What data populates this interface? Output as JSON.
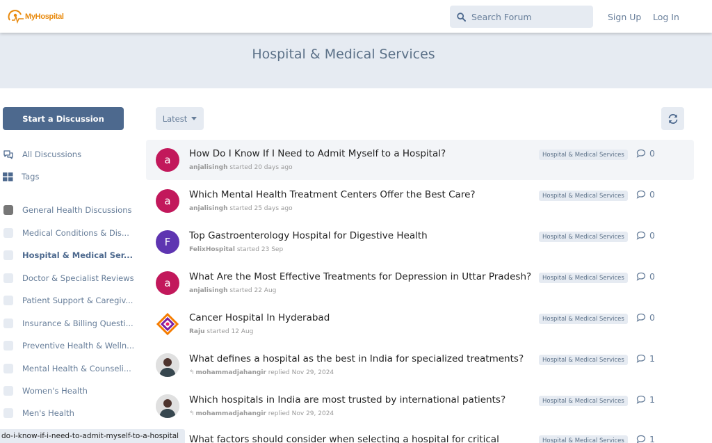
{
  "header": {
    "logo_text": "MyHospital",
    "search_placeholder": "Search Forum",
    "signup_label": "Sign Up",
    "login_label": "Log In"
  },
  "hero": {
    "title": "Hospital & Medical Services"
  },
  "sidebar": {
    "start_label": "Start a Discussion",
    "nav": [
      {
        "label": "All Discussions",
        "icon": "comments-icon"
      },
      {
        "label": "Tags",
        "icon": "grid-icon"
      }
    ],
    "tags": [
      {
        "label": "General Health Discussions"
      },
      {
        "label": "Medical Conditions & Dis..."
      },
      {
        "label": "Hospital & Medical Ser..."
      },
      {
        "label": "Doctor & Specialist Reviews"
      },
      {
        "label": "Patient Support & Caregiv..."
      },
      {
        "label": "Insurance & Billing Questi..."
      },
      {
        "label": "Preventive Health & Welln..."
      },
      {
        "label": "Mental Health & Counseli..."
      },
      {
        "label": "Women's Health"
      },
      {
        "label": "Men's Health"
      }
    ]
  },
  "toolbar": {
    "sort_label": "Latest",
    "refresh_icon": "refresh-icon"
  },
  "discussions": [
    {
      "title": "How Do I Know If I Need to Admit Myself to a Hospital?",
      "user": "anjalisingh",
      "action": "started",
      "when": "20 days ago",
      "tag": "Hospital & Medical Services",
      "count": "0",
      "avatar_letter": "a",
      "avatar_color": "#c2185b"
    },
    {
      "title": "Which Mental Health Treatment Centers Offer the Best Care?",
      "user": "anjalisingh",
      "action": "started",
      "when": "25 days ago",
      "tag": "Hospital & Medical Services",
      "count": "0",
      "avatar_letter": "a",
      "avatar_color": "#c2185b"
    },
    {
      "title": "Top Gastroenterology Hospital for Digestive Health",
      "user": "FelixHospital",
      "action": "started",
      "when": "23 Sep",
      "tag": "Hospital & Medical Services",
      "count": "0",
      "avatar_letter": "F",
      "avatar_color": "#5e35b1"
    },
    {
      "title": "What Are the Most Effective Treatments for Depression in Uttar Pradesh?",
      "user": "anjalisingh",
      "action": "started",
      "when": "22 Aug",
      "tag": "Hospital & Medical Services",
      "count": "0",
      "avatar_letter": "a",
      "avatar_color": "#c2185b"
    },
    {
      "title": "Cancer Hospital In Hyderabad",
      "user": "Raju",
      "action": "started",
      "when": "12 Aug",
      "tag": "Hospital & Medical Services",
      "count": "0",
      "avatar_letter": "",
      "avatar_color": "#ffffff"
    },
    {
      "title": "What defines a hospital as the best in India for specialized treatments?",
      "user": "mohammadjahangir",
      "action": "replied",
      "when": "Nov 29, 2024",
      "tag": "Hospital & Medical Services",
      "count": "1",
      "avatar_letter": "",
      "avatar_color": "#cfd8dc"
    },
    {
      "title": "Which hospitals in India are most trusted by international patients?",
      "user": "mohammadjahangir",
      "action": "replied",
      "when": "Nov 29, 2024",
      "tag": "Hospital & Medical Services",
      "count": "1",
      "avatar_letter": "",
      "avatar_color": "#cfd8dc"
    },
    {
      "title": "What factors should consider when selecting a hospital for critical",
      "user": "",
      "action": "",
      "when": "",
      "tag": "Hospital & Medical Services",
      "count": "1",
      "avatar_letter": "",
      "avatar_color": "#cfd8dc"
    }
  ],
  "status_url": "do-i-know-if-i-need-to-admit-myself-to-a-hospital"
}
